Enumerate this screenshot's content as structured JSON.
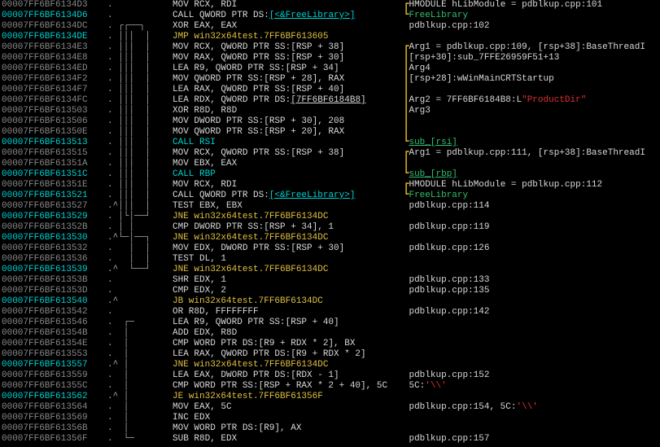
{
  "rows": [
    {
      "addr": "00007FF6BF6134D3",
      "addrClass": "addr-gray",
      "bp": false,
      "flow": ". ",
      "instrHtml": "<span class='c-def'>MOV RCX, RDI</span>",
      "commentHtml": "<span class='bracket-gold'>┏</span><span class='c-def'>HMODULE hLibModule = pdblkup.cpp:101</span>"
    },
    {
      "addr": "00007FF6BF6134D6",
      "addrClass": "addr-cyan",
      "bp": false,
      "flow": ". ",
      "instrHtml": "<span class='c-call'>CALL QWORD PTR DS:</span><span class='c-cyan underline'>[&lt;&amp;FreeLibrary&gt;]</span>",
      "commentHtml": "<span class='bracket-gold'>┗</span><span class='c-grn'>FreeLibrary</span>"
    },
    {
      "addr": "00007FF6BF6134DC",
      "addrClass": "addr-gray",
      "bp": false,
      "flow": ". ┌┌──┐ ",
      "instrHtml": "<span class='c-def'>XOR EAX, EAX</span>",
      "commentHtml": " <span class='c-def'>pdblkup.cpp:102</span>"
    },
    {
      "addr": "00007FF6BF6134DE",
      "addrClass": "addr-cyan",
      "bp": false,
      "flow": ". │││  │ ",
      "instrHtml": "<span class='c-yel'>JMP win32x64test.7FF6BF613605</span>",
      "commentHtml": ""
    },
    {
      "addr": "00007FF6BF6134E3",
      "addrClass": "addr-gray",
      "bp": false,
      "flow": ". │││  │ ",
      "instrHtml": "<span class='c-def'>MOV RCX, QWORD PTR SS:[RSP + 38]</span>",
      "commentHtml": "<span class='bracket-gold'>┏</span><span class='c-def'>Arg1 = pdblkup.cpp:109, [rsp+38]:BaseThreadI</span>"
    },
    {
      "addr": "00007FF6BF6134E8",
      "addrClass": "addr-gray",
      "bp": false,
      "flow": ". │││  │ ",
      "instrHtml": "<span class='c-def'>MOV RAX, QWORD PTR SS:[RSP + 30]</span>",
      "commentHtml": "<span class='bracket-gold'>┃</span><span class='c-def'>[rsp+30]:sub_7FFE26959F51+13</span>"
    },
    {
      "addr": "00007FF6BF6134ED",
      "addrClass": "addr-gray",
      "bp": false,
      "flow": ". │││  │ ",
      "instrHtml": "<span class='c-def'>LEA R9, QWORD PTR SS:[RSP + 34]</span>",
      "commentHtml": "<span class='bracket-gold'>┃</span><span class='c-def'>Arg4</span>"
    },
    {
      "addr": "00007FF6BF6134F2",
      "addrClass": "addr-gray",
      "bp": false,
      "flow": ". │││  │ ",
      "instrHtml": "<span class='c-def'>MOV QWORD PTR SS:[RSP + 28], RAX</span>",
      "commentHtml": "<span class='bracket-gold'>┃</span><span class='c-def'>[rsp+28]:wWinMainCRTStartup</span>"
    },
    {
      "addr": "00007FF6BF6134F7",
      "addrClass": "addr-gray",
      "bp": false,
      "flow": ". │││  │ ",
      "instrHtml": "<span class='c-def'>LEA RAX, QWORD PTR SS:[RSP + 40]</span>",
      "commentHtml": "<span class='bracket-gold'>┃</span>"
    },
    {
      "addr": "00007FF6BF6134FC",
      "addrClass": "addr-gray",
      "bp": false,
      "flow": ". │││  │ ",
      "instrHtml": "<span class='c-def'>LEA RDX, QWORD PTR DS:</span><span class='c-def underline'>[7FF6BF6184B8]</span>",
      "commentHtml": "<span class='bracket-gold'>┃</span><span class='c-def'>Arg2 = 7FF6BF6184B8:L</span><span class='c-red'>\"ProductDir\"</span>"
    },
    {
      "addr": "00007FF6BF613503",
      "addrClass": "addr-gray",
      "bp": false,
      "flow": ". │││  │ ",
      "instrHtml": "<span class='c-def'>XOR R8D, R8D</span>",
      "commentHtml": "<span class='bracket-gold'>┃</span><span class='c-def'>Arg3</span>"
    },
    {
      "addr": "00007FF6BF613506",
      "addrClass": "addr-gray",
      "bp": false,
      "flow": ". │││  │ ",
      "instrHtml": "<span class='c-def'>MOV DWORD PTR SS:[RSP + 30], 208</span>",
      "commentHtml": "<span class='bracket-gold'>┃</span>"
    },
    {
      "addr": "00007FF6BF61350E",
      "addrClass": "addr-gray",
      "bp": false,
      "flow": ". │││  │ ",
      "instrHtml": "<span class='c-def'>MOV QWORD PTR SS:[RSP + 20], RAX</span>",
      "commentHtml": "<span class='bracket-gold'>┃</span>"
    },
    {
      "addr": "00007FF6BF613513",
      "addrClass": "addr-cyan",
      "bp": false,
      "flow": ". │││  │ ",
      "instrHtml": "<span class='c-cyan'>CALL RSI</span>",
      "commentHtml": "<span class='bracket-gold'>┗</span><span class='c-lbl'>sub_[rsi]</span>"
    },
    {
      "addr": "00007FF6BF613515",
      "addrClass": "addr-gray",
      "bp": false,
      "flow": ". │││  │ ",
      "instrHtml": "<span class='c-def'>MOV RCX, QWORD PTR SS:[RSP + 38]</span>",
      "commentHtml": "<span class='bracket-gold'>┏</span><span class='c-def'>Arg1 = pdblkup.cpp:111, [rsp+38]:BaseThreadI</span>"
    },
    {
      "addr": "00007FF6BF61351A",
      "addrClass": "addr-gray",
      "bp": false,
      "flow": ". │││  │ ",
      "instrHtml": "<span class='c-def'>MOV EBX, EAX</span>",
      "commentHtml": "<span class='bracket-gold'>┃</span>"
    },
    {
      "addr": "00007FF6BF61351C",
      "addrClass": "addr-cyan",
      "bp": false,
      "flow": ". │││  │ ",
      "instrHtml": "<span class='c-cyan'>CALL RBP</span>",
      "commentHtml": "<span class='bracket-gold'>┗</span><span class='c-lbl'>sub_[rbp]</span>"
    },
    {
      "addr": "00007FF6BF61351E",
      "addrClass": "addr-gray",
      "bp": false,
      "flow": ". │││  │ ",
      "instrHtml": "<span class='c-def'>MOV RCX, RDI</span>",
      "commentHtml": "<span class='bracket-gold'>┏</span><span class='c-def'>HMODULE hLibModule = pdblkup.cpp:112</span>"
    },
    {
      "addr": "00007FF6BF613521",
      "addrClass": "addr-cyan",
      "bp": false,
      "flow": ". │││  │ ",
      "instrHtml": "<span class='c-call'>CALL QWORD PTR DS:</span><span class='c-cyan underline'>[&lt;&amp;FreeLibrary&gt;]</span>",
      "commentHtml": "<span class='bracket-gold'>┗</span><span class='c-grn'>FreeLibrary</span>"
    },
    {
      "addr": "00007FF6BF613527",
      "addrClass": "addr-gray",
      "bp": false,
      "flow": ".^│││  │ ",
      "instrHtml": "<span class='c-def'>TEST EBX, EBX</span>",
      "commentHtml": " <span class='c-def'>pdblkup.cpp:114</span>"
    },
    {
      "addr": "00007FF6BF613529",
      "addrClass": "addr-cyan",
      "bp": false,
      "flow": ". │└│──┘ ",
      "instrHtml": "<span class='c-yel'>JNE win32x64test.7FF6BF6134DC</span>",
      "commentHtml": ""
    },
    {
      "addr": "00007FF6BF61352B",
      "addrClass": "addr-gray",
      "bp": false,
      "flow": ". │ │    ",
      "instrHtml": "<span class='c-def'>CMP DWORD PTR SS:[RSP + 34], 1</span>",
      "commentHtml": " <span class='c-def'>pdblkup.cpp:119</span>"
    },
    {
      "addr": "00007FF6BF613530",
      "addrClass": "addr-cyan",
      "bp": false,
      "flow": ".^└─│──┐ ",
      "instrHtml": "<span class='c-yel'>JNE win32x64test.7FF6BF6134DC</span>",
      "commentHtml": ""
    },
    {
      "addr": "00007FF6BF613532",
      "addrClass": "addr-gray",
      "bp": false,
      "flow": ".   │  │ ",
      "instrHtml": "<span class='c-def'>MOV EDX, DWORD PTR SS:[RSP + 30]</span>",
      "commentHtml": " <span class='c-def'>pdblkup.cpp:126</span>"
    },
    {
      "addr": "00007FF6BF613536",
      "addrClass": "addr-gray",
      "bp": false,
      "flow": ".   │  │ ",
      "instrHtml": "<span class='c-def'>TEST DL, 1</span>",
      "commentHtml": ""
    },
    {
      "addr": "00007FF6BF613539",
      "addrClass": "addr-cyan",
      "bp": false,
      "flow": ".^  └──┘ ",
      "instrHtml": "<span class='c-yel'>JNE win32x64test.7FF6BF6134DC</span>",
      "commentHtml": ""
    },
    {
      "addr": "00007FF6BF61353B",
      "addrClass": "addr-gray",
      "bp": false,
      "flow": ".        ",
      "instrHtml": "<span class='c-def'>SHR EDX, 1</span>",
      "commentHtml": " <span class='c-def'>pdblkup.cpp:133</span>"
    },
    {
      "addr": "00007FF6BF61353D",
      "addrClass": "addr-gray",
      "bp": false,
      "flow": ".        ",
      "instrHtml": "<span class='c-def'>CMP EDX, 2</span>",
      "commentHtml": " <span class='c-def'>pdblkup.cpp:135</span>"
    },
    {
      "addr": "00007FF6BF613540",
      "addrClass": "addr-cyan",
      "bp": false,
      "flow": ".^       ",
      "instrHtml": "<span class='c-yel'>JB win32x64test.7FF6BF6134DC</span>",
      "commentHtml": ""
    },
    {
      "addr": "00007FF6BF613542",
      "addrClass": "addr-gray",
      "bp": false,
      "flow": ".        ",
      "instrHtml": "<span class='c-def'>OR R8D, FFFFFFFF</span>",
      "commentHtml": " <span class='c-def'>pdblkup.cpp:142</span>"
    },
    {
      "addr": "00007FF6BF613546",
      "addrClass": "addr-gray",
      "bp": false,
      "flow": ".  ┌─    ",
      "instrHtml": "<span class='c-def'>LEA R9, QWORD PTR SS:[RSP + 40]</span>",
      "commentHtml": ""
    },
    {
      "addr": "00007FF6BF61354B",
      "addrClass": "addr-gray",
      "bp": false,
      "flow": ".  │     ",
      "instrHtml": "<span class='c-def'>ADD EDX, R8D</span>",
      "commentHtml": ""
    },
    {
      "addr": "00007FF6BF61354E",
      "addrClass": "addr-gray",
      "bp": false,
      "flow": ".  │     ",
      "instrHtml": "<span class='c-def'>CMP WORD PTR DS:[R9 + RDX * 2], BX</span>",
      "commentHtml": ""
    },
    {
      "addr": "00007FF6BF613553",
      "addrClass": "addr-gray",
      "bp": false,
      "flow": ".  │     ",
      "instrHtml": "<span class='c-def'>LEA RAX, QWORD PTR DS:[R9 + RDX * 2]</span>",
      "commentHtml": ""
    },
    {
      "addr": "00007FF6BF613557",
      "addrClass": "addr-cyan",
      "bp": false,
      "flow": ".^ │     ",
      "instrHtml": "<span class='c-yel'>JNE win32x64test.7FF6BF6134DC</span>",
      "commentHtml": ""
    },
    {
      "addr": "00007FF6BF613559",
      "addrClass": "addr-gray",
      "bp": false,
      "flow": ".  │     ",
      "instrHtml": "<span class='c-def'>LEA EAX, DWORD PTR DS:[RDX - 1]</span>",
      "commentHtml": " <span class='c-def'>pdblkup.cpp:152</span>"
    },
    {
      "addr": "00007FF6BF61355C",
      "addrClass": "addr-gray",
      "bp": false,
      "flow": ".  │     ",
      "instrHtml": "<span class='c-def'>CMP WORD PTR SS:[RSP + RAX * 2 + 40], 5C</span>",
      "commentHtml": " <span class='c-def'>5C:</span><span class='c-red'>'\\\\'</span>"
    },
    {
      "addr": "00007FF6BF613562",
      "addrClass": "addr-cyan",
      "bp": false,
      "flow": ".^ │     ",
      "instrHtml": "<span class='c-yel'>JE win32x64test.7FF6BF61356F</span>",
      "commentHtml": ""
    },
    {
      "addr": "00007FF6BF613564",
      "addrClass": "addr-gray",
      "bp": false,
      "flow": ".  │     ",
      "instrHtml": "<span class='c-def'>MOV EAX, 5C</span>",
      "commentHtml": " <span class='c-def'>pdblkup.cpp:154, 5C:</span><span class='c-red'>'\\\\'</span>"
    },
    {
      "addr": "00007FF6BF613569",
      "addrClass": "addr-gray",
      "bp": false,
      "flow": ".  │     ",
      "instrHtml": "<span class='c-def'>INC EDX</span>",
      "commentHtml": ""
    },
    {
      "addr": "00007FF6BF61356B",
      "addrClass": "addr-gray",
      "bp": false,
      "flow": ".  │     ",
      "instrHtml": "<span class='c-def'>MOV WORD PTR DS:[R9], AX</span>",
      "commentHtml": ""
    },
    {
      "addr": "00007FF6BF61356F",
      "addrClass": "addr-gray",
      "bp": false,
      "flow": ".  └─    ",
      "instrHtml": "<span class='c-def'>SUB R8D, EDX</span>",
      "commentHtml": " <span class='c-def'>pdblkup.cpp:157</span>"
    }
  ]
}
